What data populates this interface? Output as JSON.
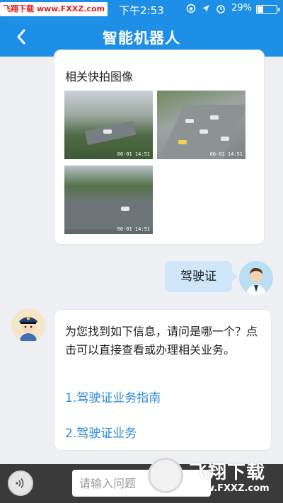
{
  "status_bar": {
    "watermark": "飞翔下载 www.FXXZ.com",
    "time": "下午2:53",
    "icons": [
      "orientation-lock-icon",
      "location-icon",
      "alarm-icon"
    ],
    "battery_percent": "29%",
    "battery_level": 0.29
  },
  "nav": {
    "back_icon": "chevron-left-icon",
    "title": "智能机器人"
  },
  "messages": {
    "photos_card": {
      "title": "相关快拍图像",
      "photos": [
        {
          "stamp": "06-01 14:51"
        },
        {
          "stamp": "06-01 14:51"
        },
        {
          "stamp": "06-01 14:51"
        }
      ]
    },
    "user_message": "驾驶证",
    "bot_answer": {
      "text": "为您找到如下信息，请问是哪一个？点击可以直接查看或办理相关业务。",
      "links": [
        "1.驾驶证业务指南",
        "2.驾驶证业务"
      ]
    }
  },
  "input_bar": {
    "voice_icon": "voice-icon",
    "placeholder": "请输入问题"
  },
  "watermark_logo": {
    "name": "飞翔下载",
    "url": "www.FXXZ.com"
  },
  "colors": {
    "header_blue": "#1e8fe6",
    "user_bubble": "#cfe6fb",
    "link_blue": "#2b8ad8",
    "input_bar": "#3a3a3a"
  }
}
